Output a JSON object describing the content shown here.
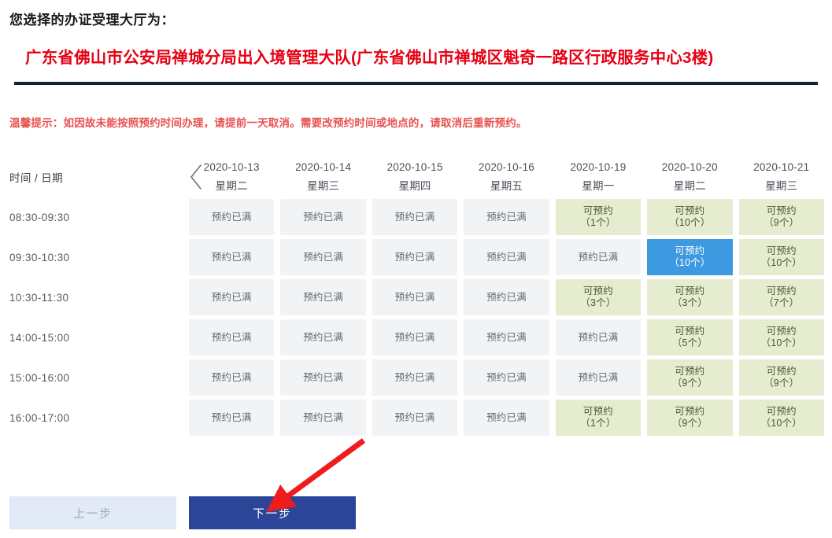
{
  "header": {
    "prompt": "您选择的办证受理大厅为：",
    "hall_name": "广东省佛山市公安局禅城分局出入境管理大队(广东省佛山市禅城区魁奇一路区行政服务中心3楼)",
    "rule_color": "#152235"
  },
  "tip": {
    "text": "温馨提示：如因故未能按照预约时间办理，请提前一天取消。需要改预约时间或地点的，请取消后重新预约。",
    "color": "#e8524f"
  },
  "schedule": {
    "corner_label": "时间 / 日期",
    "prev_icon": "chevron-left-icon",
    "columns": [
      {
        "date": "2020-10-13",
        "weekday": "星期二"
      },
      {
        "date": "2020-10-14",
        "weekday": "星期三"
      },
      {
        "date": "2020-10-15",
        "weekday": "星期四"
      },
      {
        "date": "2020-10-16",
        "weekday": "星期五"
      },
      {
        "date": "2020-10-19",
        "weekday": "星期一"
      },
      {
        "date": "2020-10-20",
        "weekday": "星期二"
      },
      {
        "date": "2020-10-21",
        "weekday": "星期三"
      }
    ],
    "status_labels": {
      "full": "预约已满",
      "open": "可预约"
    },
    "colors": {
      "full_bg": "#f2f3f5",
      "full_text": "#62686f",
      "open_bg": "#e6eccf",
      "open_text": "#4a5a30",
      "selected_bg": "#3d9ae0",
      "selected_text": "#ffffff"
    },
    "rows": [
      {
        "time": "08:30-09:30",
        "cells": [
          {
            "state": "full",
            "line1": "预约已满",
            "line2": ""
          },
          {
            "state": "full",
            "line1": "预约已满",
            "line2": ""
          },
          {
            "state": "full",
            "line1": "预约已满",
            "line2": ""
          },
          {
            "state": "full",
            "line1": "预约已满",
            "line2": ""
          },
          {
            "state": "open",
            "line1": "可预约",
            "line2": "（1个）",
            "count": 1
          },
          {
            "state": "open",
            "line1": "可预约",
            "line2": "（10个）",
            "count": 10
          },
          {
            "state": "open",
            "line1": "可预约",
            "line2": "（9个）",
            "count": 9
          }
        ]
      },
      {
        "time": "09:30-10:30",
        "cells": [
          {
            "state": "full",
            "line1": "预约已满",
            "line2": ""
          },
          {
            "state": "full",
            "line1": "预约已满",
            "line2": ""
          },
          {
            "state": "full",
            "line1": "预约已满",
            "line2": ""
          },
          {
            "state": "full",
            "line1": "预约已满",
            "line2": ""
          },
          {
            "state": "full",
            "line1": "预约已满",
            "line2": ""
          },
          {
            "state": "selected",
            "line1": "可预约",
            "line2": "（10个）",
            "count": 10
          },
          {
            "state": "open",
            "line1": "可预约",
            "line2": "（10个）",
            "count": 10
          }
        ]
      },
      {
        "time": "10:30-11:30",
        "cells": [
          {
            "state": "full",
            "line1": "预约已满",
            "line2": ""
          },
          {
            "state": "full",
            "line1": "预约已满",
            "line2": ""
          },
          {
            "state": "full",
            "line1": "预约已满",
            "line2": ""
          },
          {
            "state": "full",
            "line1": "预约已满",
            "line2": ""
          },
          {
            "state": "open",
            "line1": "可预约",
            "line2": "（3个）",
            "count": 3
          },
          {
            "state": "open",
            "line1": "可预约",
            "line2": "（3个）",
            "count": 3
          },
          {
            "state": "open",
            "line1": "可预约",
            "line2": "（7个）",
            "count": 7
          }
        ]
      },
      {
        "time": "14:00-15:00",
        "cells": [
          {
            "state": "full",
            "line1": "预约已满",
            "line2": ""
          },
          {
            "state": "full",
            "line1": "预约已满",
            "line2": ""
          },
          {
            "state": "full",
            "line1": "预约已满",
            "line2": ""
          },
          {
            "state": "full",
            "line1": "预约已满",
            "line2": ""
          },
          {
            "state": "full",
            "line1": "预约已满",
            "line2": ""
          },
          {
            "state": "open",
            "line1": "可预约",
            "line2": "（5个）",
            "count": 5
          },
          {
            "state": "open",
            "line1": "可预约",
            "line2": "（10个）",
            "count": 10
          }
        ]
      },
      {
        "time": "15:00-16:00",
        "cells": [
          {
            "state": "full",
            "line1": "预约已满",
            "line2": ""
          },
          {
            "state": "full",
            "line1": "预约已满",
            "line2": ""
          },
          {
            "state": "full",
            "line1": "预约已满",
            "line2": ""
          },
          {
            "state": "full",
            "line1": "预约已满",
            "line2": ""
          },
          {
            "state": "full",
            "line1": "预约已满",
            "line2": ""
          },
          {
            "state": "open",
            "line1": "可预约",
            "line2": "（9个）",
            "count": 9
          },
          {
            "state": "open",
            "line1": "可预约",
            "line2": "（9个）",
            "count": 9
          }
        ]
      },
      {
        "time": "16:00-17:00",
        "cells": [
          {
            "state": "full",
            "line1": "预约已满",
            "line2": ""
          },
          {
            "state": "full",
            "line1": "预约已满",
            "line2": ""
          },
          {
            "state": "full",
            "line1": "预约已满",
            "line2": ""
          },
          {
            "state": "full",
            "line1": "预约已满",
            "line2": ""
          },
          {
            "state": "open",
            "line1": "可预约",
            "line2": "（1个）",
            "count": 1
          },
          {
            "state": "open",
            "line1": "可预约",
            "line2": "（9个）",
            "count": 9
          },
          {
            "state": "open",
            "line1": "可预约",
            "line2": "（10个）",
            "count": 10
          }
        ]
      }
    ]
  },
  "footer": {
    "prev_label": "上一步",
    "next_label": "下一步",
    "prev_bg": "#e2e9f7",
    "next_bg": "#2b4698"
  },
  "annotation": {
    "arrow_color": "#ee1c1c",
    "points_to": "下一步"
  }
}
